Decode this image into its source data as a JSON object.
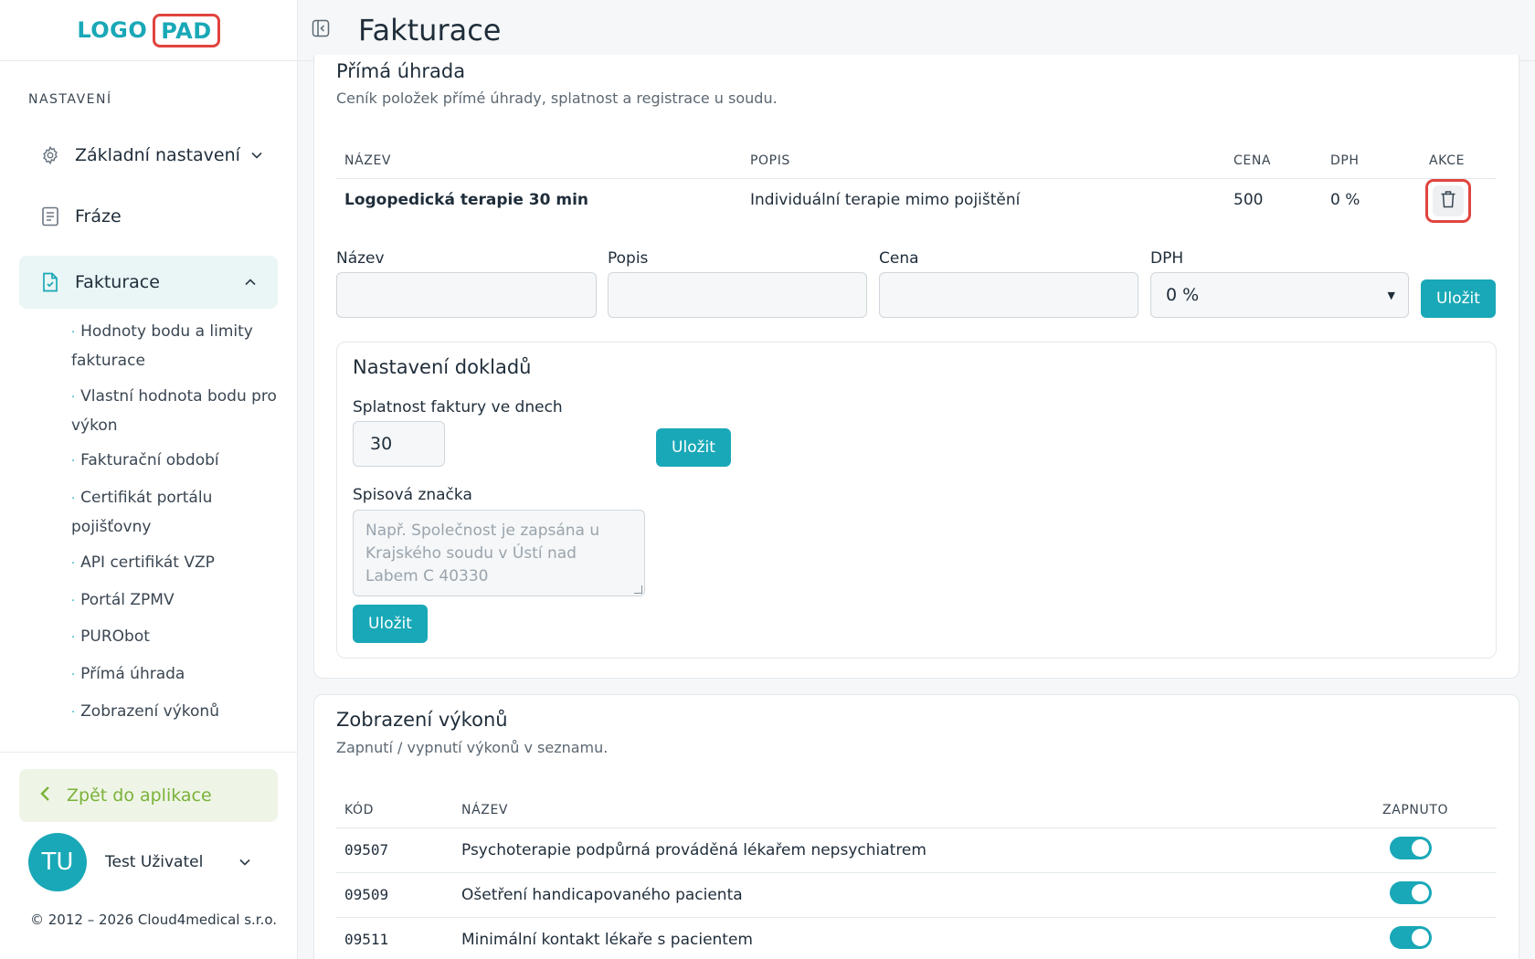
{
  "logo": {
    "part1": "LOGO",
    "part2": "PAD"
  },
  "sidebar": {
    "section": "NASTAVENÍ",
    "items": [
      {
        "label": "Základní nastavení",
        "icon": "gear-icon"
      },
      {
        "label": "Fráze",
        "icon": "document-icon"
      },
      {
        "label": "Fakturace",
        "icon": "invoice-icon"
      }
    ],
    "sub_items": [
      {
        "line1": "Hodnoty bodu a limity",
        "line2": "fakturace"
      },
      {
        "line1": "Vlastní hodnota bodu pro",
        "line2": "výkon"
      },
      {
        "line1": "Fakturační období",
        "line2": ""
      },
      {
        "line1": "Certifikát portálu",
        "line2": "pojišťovny"
      },
      {
        "line1": "API certifikát VZP",
        "line2": ""
      },
      {
        "line1": "Portál ZPMV",
        "line2": ""
      },
      {
        "line1": "PURObot",
        "line2": ""
      },
      {
        "line1": "Přímá úhrada",
        "line2": ""
      },
      {
        "line1": "Zobrazení výkonů",
        "line2": ""
      }
    ],
    "back_label": "Zpět do aplikace",
    "user": {
      "initials": "TU",
      "name": "Test Uživatel"
    },
    "copyright": "© 2012 – 2026 Cloud4medical s.r.o."
  },
  "header": {
    "title": "Fakturace"
  },
  "direct_payment": {
    "title": "Přímá úhrada",
    "subtitle": "Ceník položek přímé úhrady, splatnost a registrace u soudu.",
    "columns": [
      "NÁZEV",
      "POPIS",
      "CENA",
      "DPH",
      "AKCE"
    ],
    "rows": [
      {
        "name": "Logopedická terapie 30 min",
        "description": "Individuální terapie mimo pojištění",
        "price": "500",
        "vat": "0 %"
      }
    ],
    "form": {
      "name_label": "Název",
      "description_label": "Popis",
      "price_label": "Cena",
      "vat_label": "DPH",
      "vat_value": "0 %",
      "save_label": "Uložit"
    }
  },
  "documents": {
    "title": "Nastavení dokladů",
    "due_label": "Splatnost faktury ve dnech",
    "due_value": "30",
    "save_label": "Uložit",
    "file_label": "Spisová značka",
    "file_placeholder": "Např. Společnost je zapsána u Krajského soudu v Ústí nad Labem C 40330",
    "save_label2": "Uložit"
  },
  "procedures": {
    "title": "Zobrazení výkonů",
    "subtitle": "Zapnutí / vypnutí výkonů v seznamu.",
    "columns": [
      "KÓD",
      "NÁZEV",
      "ZAPNUTO"
    ],
    "rows": [
      {
        "code": "09507",
        "name": "Psychoterapie podpůrná prováděná lékařem nepsychiatrem",
        "enabled": true
      },
      {
        "code": "09509",
        "name": "Ošetření handicapovaného pacienta",
        "enabled": true
      },
      {
        "code": "09511",
        "name": "Minimální kontakt lékaře s pacientem",
        "enabled": true
      }
    ]
  },
  "colors": {
    "accent": "#19a8b7",
    "danger": "#e0443f",
    "back_green": "#7bb23a"
  }
}
